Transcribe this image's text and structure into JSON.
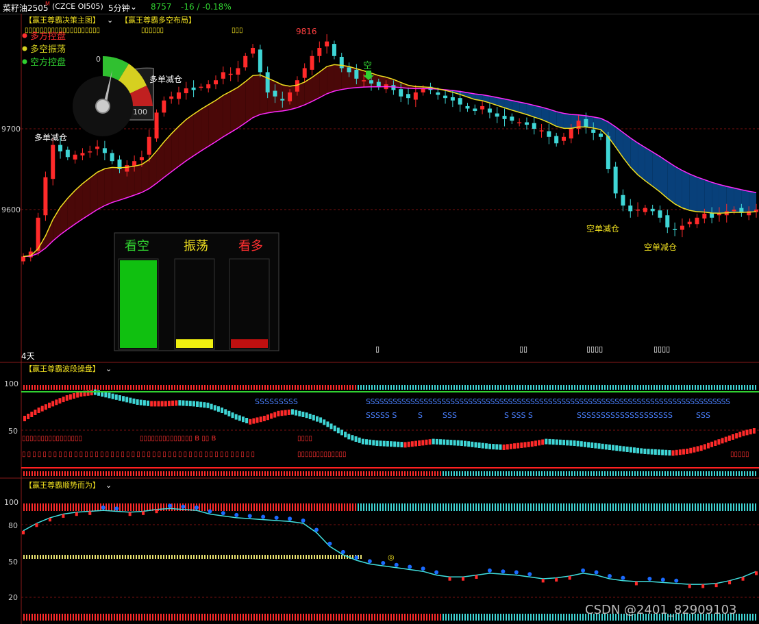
{
  "header": {
    "instrument": "菜籽油2505",
    "superscript": "M",
    "code": "(CZCE OI505)",
    "period": "5分钟",
    "last_price": "8757",
    "change": "-16 / -0.18%"
  },
  "colors": {
    "up": "#ff2a2a",
    "down": "#3fd6d6",
    "yellow": "#f0e020",
    "magenta": "#ff2aff",
    "green": "#30d030",
    "blue_band": "#08407a",
    "red_band": "#4a0808",
    "dot_blue": "#1a6aff",
    "grid": "#7a1010",
    "panel_border": "#8a1a1a"
  },
  "main_panel": {
    "indicator_1": "【赢王尊霸决策主图】",
    "indicator_2": "【赢王尊霸多空布局】",
    "glyph_row_1": "▯▯▯▯▯▯▯▯▯▯▯▯▯▯▯▯▯▯▯▯",
    "glyph_row_2": "▯▯▯▯▯▯",
    "glyph_row_3": "▯▯▯",
    "legend": [
      {
        "text": "多方控盘",
        "color": "#ff3030"
      },
      {
        "text": "多空振荡",
        "color": "#d6d020"
      },
      {
        "text": "空方控盘",
        "color": "#30d030"
      }
    ],
    "gauge": {
      "min_label": "0",
      "max_label": "100",
      "value": 15
    },
    "y_ticks": [
      "9700",
      "9600"
    ],
    "high_label": "9816",
    "signal_kong": "空",
    "annotations": [
      {
        "text": "多单减仓",
        "color": "#ffffff"
      },
      {
        "text": "多单减仓",
        "color": "#ffffff"
      },
      {
        "text": "空单减仓",
        "color": "#f0e020"
      },
      {
        "text": "空单减仓",
        "color": "#f0e020"
      }
    ],
    "bars_box": {
      "labels": [
        "看空",
        "振荡",
        "看多"
      ],
      "label_colors": [
        "#30d030",
        "#f0e020",
        "#ff3030"
      ],
      "levels": [
        1.0,
        0.1,
        0.1
      ]
    },
    "days_label": "4天",
    "bottom_glyphs": [
      "▯",
      "▯▯",
      "▯▯▯▯",
      "▯▯▯▯"
    ]
  },
  "wave_panel": {
    "title": "【赢王尊霸波段操盘】",
    "y_ticks": [
      "100",
      "50"
    ],
    "s_row_1": "SSSSSSSSS",
    "s_row_2": "SSSSSSSSSSSSSSSSSSSSSSSSSSSSSSSSSSSSSSSSSSSSSSSSSSSSSSSSSSSSSSSSSSSSSSSSSSSSSSSSSS",
    "s_row_3": [
      "SSSSS  S",
      "S",
      "SSS",
      "S  SSS  S",
      "SSSSSSSSSSSSSSSSSSSS",
      "SSS"
    ],
    "b_row_1": [
      "▯▯▯▯▯▯▯▯▯▯▯▯▯▯▯▯",
      "▯▯▯▯▯▯▯▯▯▯▯▯▯▯  B  ▯▯  B",
      "▯▯▯▯"
    ],
    "b_row_2": [
      "▯▯▯▯▯▯▯▯▯▯▯▯▯▯▯▯▯▯▯▯▯▯▯▯▯▯▯▯▯▯▯▯▯▯▯▯▯▯▯▯▯▯▯▯▯",
      "▯▯▯▯▯▯▯▯▯▯▯▯▯",
      "▯▯▯▯▯"
    ]
  },
  "trend_panel": {
    "title": "【赢王尊霸顺势而为】",
    "y_ticks": [
      "100",
      "80",
      "50",
      "20"
    ],
    "marker": "◎"
  },
  "watermark": "CSDN @2401_82909103",
  "chart_data": {
    "type": "candlestick",
    "x": "bar index (5-minute)",
    "price_range": [
      9510,
      9840
    ],
    "ohlc_sample_count": 130,
    "key_levels": {
      "high": 9816,
      "tick_9700": 9700,
      "tick_9600": 9600
    },
    "close_path": [
      9542,
      9548,
      9590,
      9640,
      9680,
      9672,
      9665,
      9668,
      9670,
      9672,
      9678,
      9670,
      9660,
      9650,
      9655,
      9660,
      9665,
      9690,
      9720,
      9735,
      9740,
      9745,
      9750,
      9748,
      9752,
      9755,
      9760,
      9770,
      9768,
      9775,
      9790,
      9800,
      9770,
      9745,
      9740,
      9735,
      9745,
      9760,
      9775,
      9790,
      9800,
      9808,
      9790,
      9775,
      9770,
      9762,
      9760,
      9756,
      9752,
      9755,
      9748,
      9740,
      9738,
      9745,
      9750,
      9748,
      9742,
      9738,
      9735,
      9730,
      9725,
      9722,
      9728,
      9720,
      9715,
      9712,
      9710,
      9708,
      9705,
      9700,
      9698,
      9690,
      9682,
      9690,
      9700,
      9710,
      9702,
      9695,
      9690,
      9650,
      9620,
      9605,
      9598,
      9600,
      9602,
      9598,
      9590,
      9578,
      9575,
      9580,
      9585,
      9590,
      9595,
      9590,
      9595,
      9598,
      9600,
      9596,
      9598,
      9600
    ],
    "wave_oscillator_range": [
      0,
      100
    ],
    "trend_oscillator_range": [
      0,
      100
    ]
  }
}
